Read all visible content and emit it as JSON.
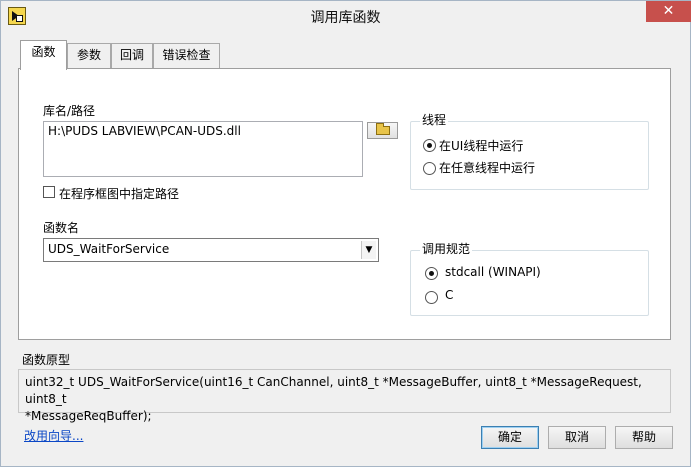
{
  "window": {
    "title": "调用库函数",
    "close_glyph": "✕"
  },
  "tabs": [
    {
      "label": "函数",
      "active": true
    },
    {
      "label": "参数",
      "active": false
    },
    {
      "label": "回调",
      "active": false
    },
    {
      "label": "错误检查",
      "active": false
    }
  ],
  "library": {
    "label": "库名/路径",
    "path_value": "H:\\PUDS LABVIEW\\PCAN-UDS.dll",
    "browse_icon": "folder-open-icon",
    "specify_path_label": "在程序框图中指定路径",
    "specify_path_checked": false
  },
  "function": {
    "label": "函数名",
    "selected": "UDS_WaitForService"
  },
  "thread": {
    "title": "线程",
    "options": [
      {
        "label": "在UI线程中运行",
        "checked": true
      },
      {
        "label": "在任意线程中运行",
        "checked": false
      }
    ]
  },
  "calling_convention": {
    "title": "调用规范",
    "options": [
      {
        "label": "stdcall (WINAPI)",
        "checked": true
      },
      {
        "label": "C",
        "checked": false
      }
    ]
  },
  "prototype": {
    "label": "函数原型",
    "line1": "uint32_t UDS_WaitForService(uint16_t CanChannel, uint8_t *MessageBuffer, uint8_t *MessageRequest, uint8_t",
    "line2": "*MessageReqBuffer);"
  },
  "footer": {
    "wizard_link": "改用向导...",
    "ok": "确定",
    "cancel": "取消",
    "help": "帮助"
  }
}
